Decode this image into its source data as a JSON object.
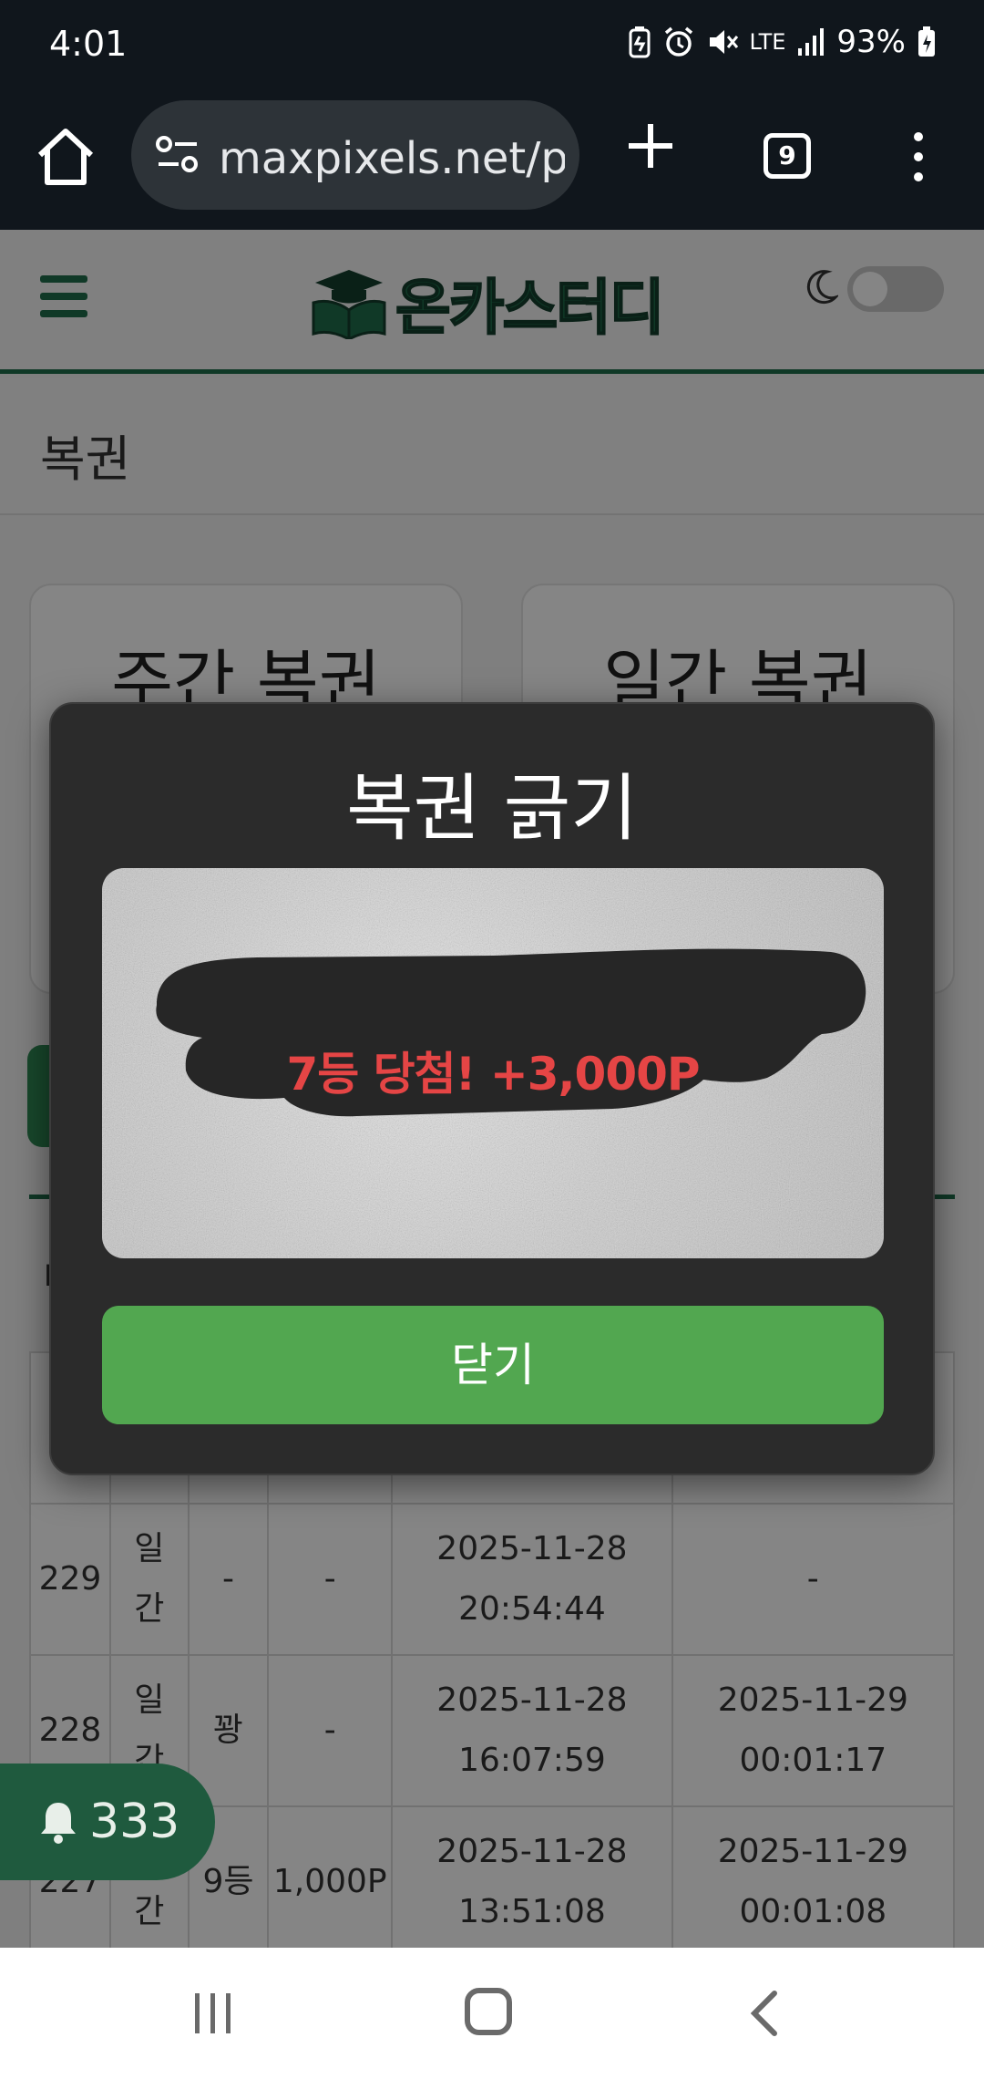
{
  "status_bar": {
    "time": "4:01",
    "network": "LTE",
    "battery": "93%"
  },
  "browser": {
    "url": "maxpixels.net/p",
    "tab_count": "9"
  },
  "site": {
    "logo_text": "온카스터디",
    "page_title": "복권"
  },
  "cards": [
    {
      "title": "주간 복권"
    },
    {
      "title": "일간 복권"
    }
  ],
  "table": {
    "rows": [
      {
        "id": "",
        "type": "",
        "rank": "",
        "prize": "",
        "created": "",
        "checked": ""
      },
      {
        "id": "229",
        "type": "일간",
        "rank": "-",
        "prize": "-",
        "created": "2025-11-28 20:54:44",
        "checked": "-"
      },
      {
        "id": "228",
        "type": "일간",
        "rank": "꽝",
        "prize": "-",
        "created": "2025-11-28 16:07:59",
        "checked": "2025-11-29 00:01:17"
      },
      {
        "id": "227",
        "type": "일간",
        "rank": "9등",
        "prize": "1,000P",
        "created": "2025-11-28 13:51:08",
        "checked": "2025-11-29 00:01:08"
      }
    ]
  },
  "modal": {
    "title": "복권 긁기",
    "result": "7등 당첨! +3,000P",
    "close_label": "닫기"
  },
  "notification": {
    "count": "333"
  },
  "colors": {
    "brand_green": "#1f6e4c",
    "close_button": "#52a750",
    "prize_red": "#e54545",
    "modal_bg": "#2b2b2b"
  }
}
